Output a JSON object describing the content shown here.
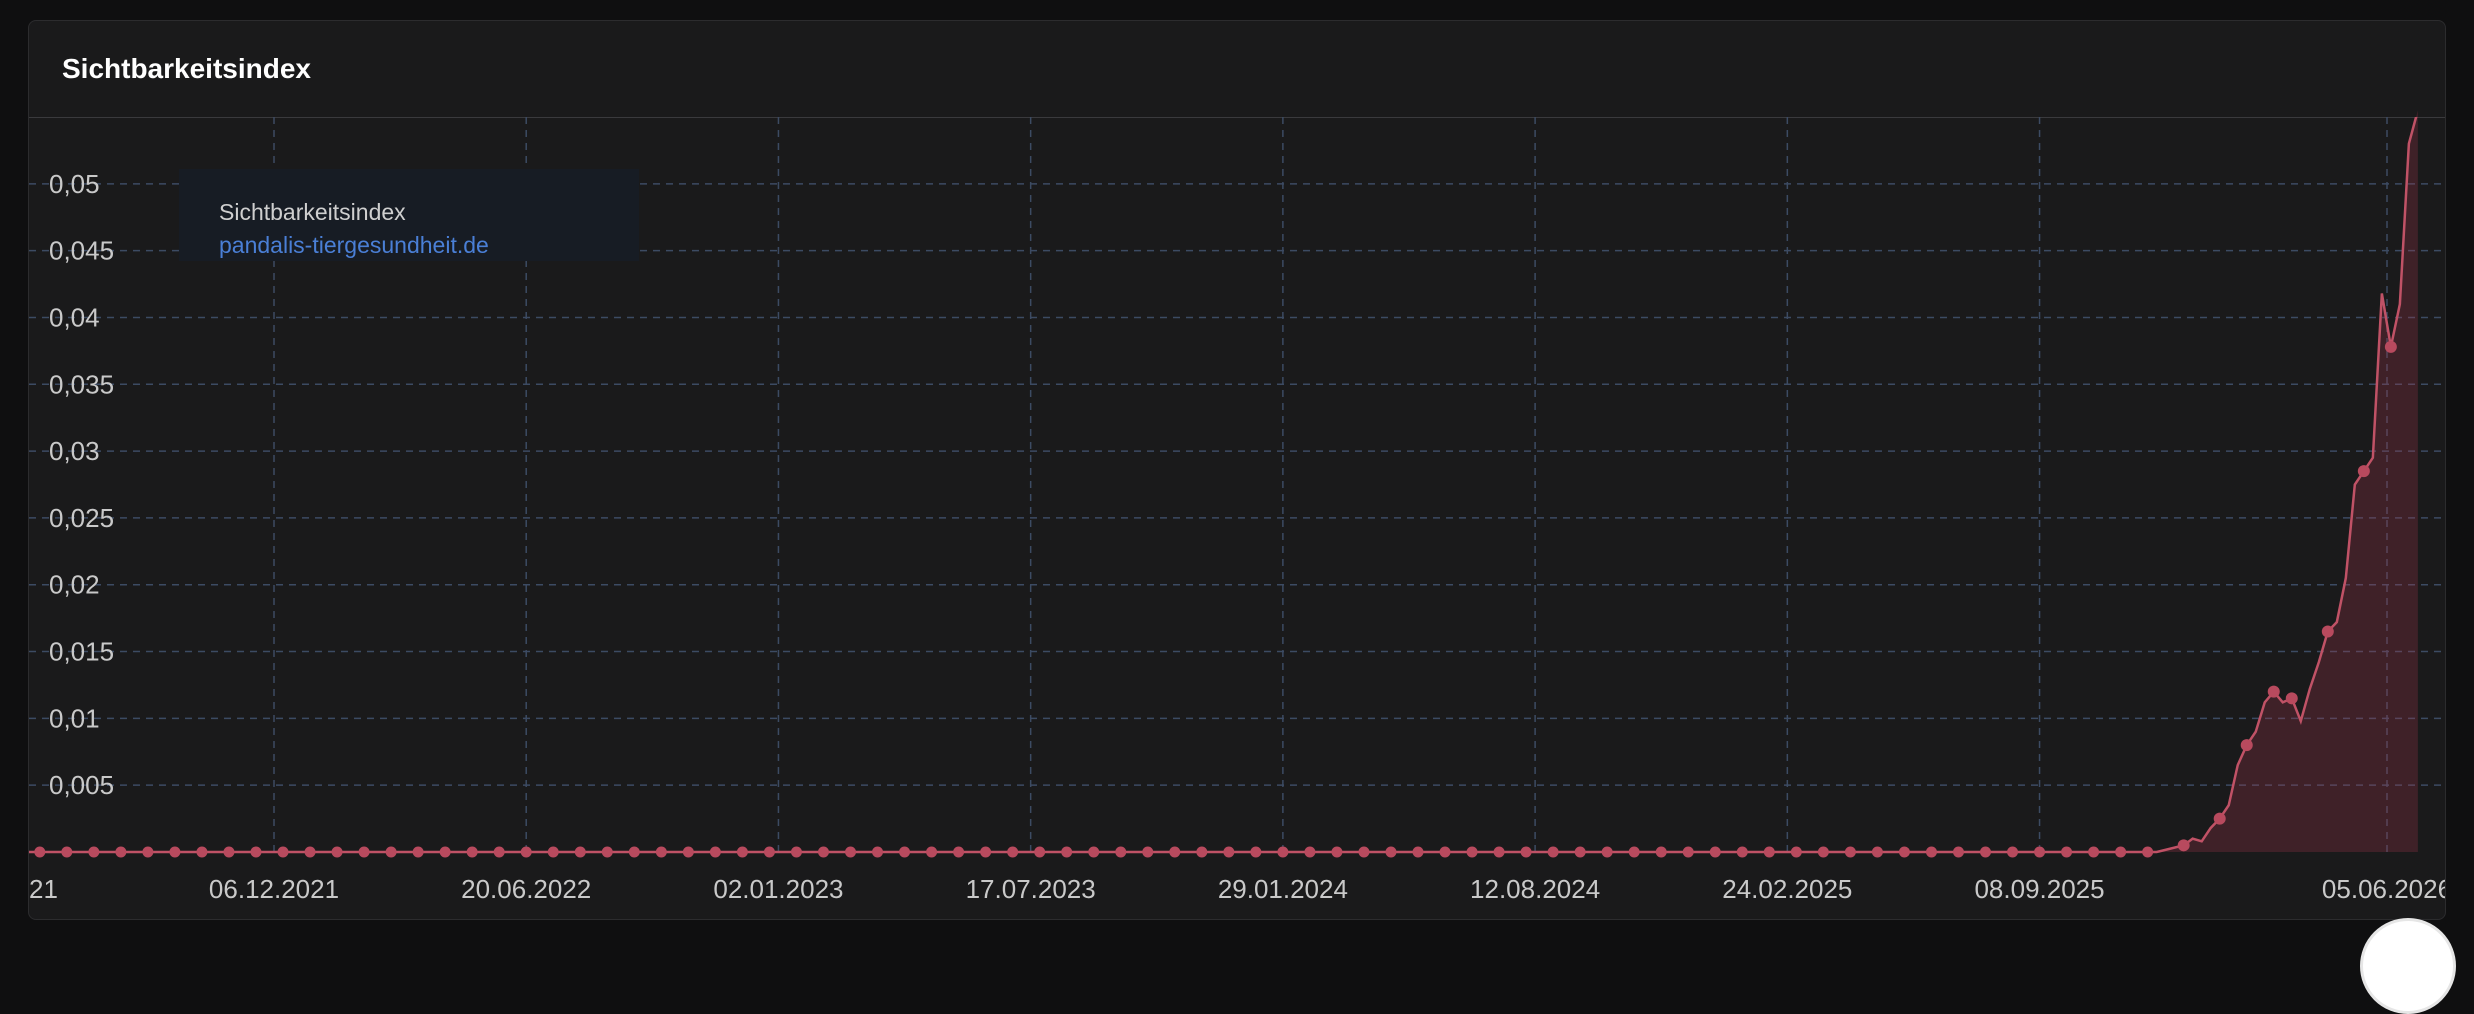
{
  "panel": {
    "title": "Sichtbarkeitsindex"
  },
  "legend": {
    "title": "Sichtbarkeitsindex",
    "series_name": "pandalis-tiergesundheit.de"
  },
  "colors": {
    "line": "#c05266",
    "point": "#b84a5e",
    "area": "rgba(160,55,75,0.28)",
    "grid": "#3c4b63",
    "legend_link": "#4a7fd6"
  },
  "chart_data": {
    "type": "line",
    "title": "Sichtbarkeitsindex",
    "xlabel": "",
    "ylabel": "",
    "ylim": [
      0,
      0.055
    ],
    "grid": true,
    "legend_position": "top-left",
    "x_tick_labels": [
      "21",
      "06.12.2021",
      "20.06.2022",
      "02.01.2023",
      "17.07.2023",
      "29.01.2024",
      "12.08.2024",
      "24.02.2025",
      "08.09.2025",
      "05.06.2026"
    ],
    "y_ticks": [
      0.005,
      0.01,
      0.015,
      0.02,
      0.025,
      0.03,
      0.035,
      0.04,
      0.045,
      0.05
    ],
    "y_tick_labels": [
      "0,005",
      "0,01",
      "0,015",
      "0,02",
      "0,025",
      "0,03",
      "0,035",
      "0,04",
      "0,045",
      "0,05"
    ],
    "series": [
      {
        "name": "pandalis-tiergesundheit.de",
        "points": [
          [
            "2021-05-17",
            0
          ],
          [
            "2025-12-08",
            0
          ],
          [
            "2025-12-29",
            0.0005
          ],
          [
            "2026-01-05",
            0.001
          ],
          [
            "2026-01-12",
            0.0008
          ],
          [
            "2026-01-19",
            0.0018
          ],
          [
            "2026-01-26",
            0.0025
          ],
          [
            "2026-02-02",
            0.0035
          ],
          [
            "2026-02-09",
            0.0065
          ],
          [
            "2026-02-16",
            0.008
          ],
          [
            "2026-02-23",
            0.009
          ],
          [
            "2026-03-02",
            0.0112
          ],
          [
            "2026-03-09",
            0.012
          ],
          [
            "2026-03-16",
            0.0112
          ],
          [
            "2026-03-23",
            0.0115
          ],
          [
            "2026-03-30",
            0.0098
          ],
          [
            "2026-04-06",
            0.0122
          ],
          [
            "2026-04-13",
            0.0142
          ],
          [
            "2026-04-20",
            0.0165
          ],
          [
            "2026-04-27",
            0.0172
          ],
          [
            "2026-05-04",
            0.0205
          ],
          [
            "2026-05-11",
            0.0275
          ],
          [
            "2026-05-18",
            0.0285
          ],
          [
            "2026-05-25",
            0.0295
          ],
          [
            "2026-06-01",
            0.0418
          ],
          [
            "2026-06-08",
            0.0378
          ],
          [
            "2026-06-15",
            0.041
          ],
          [
            "2026-06-22",
            0.053
          ],
          [
            "2026-06-29",
            0.0555
          ]
        ]
      }
    ]
  }
}
